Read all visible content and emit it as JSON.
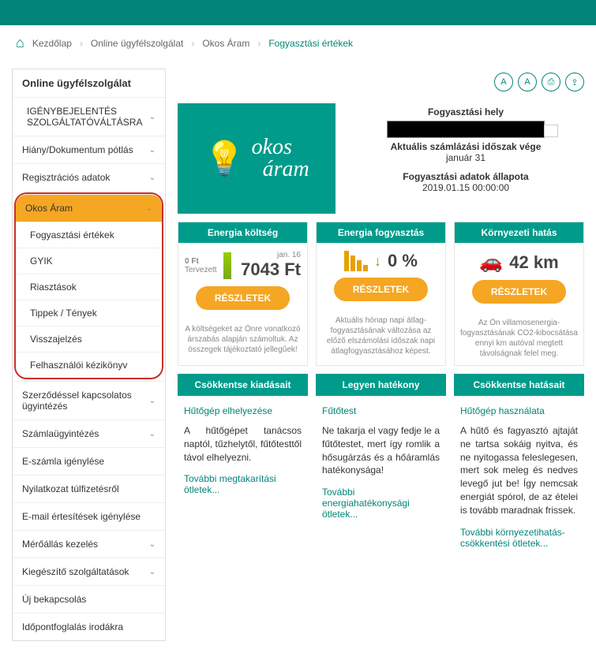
{
  "breadcrumb": {
    "home": "Kezdőlap",
    "b2": "Online ügyfélszolgálat",
    "b3": "Okos Áram",
    "current": "Fogyasztási értékek"
  },
  "sidebar": {
    "title": "Online ügyfélszolgálat",
    "items": [
      {
        "label": "IGÉNYBEJELENTÉS SZOLGÁLTATÓVÁLTÁSRA",
        "exp": true
      },
      {
        "label": "Hiány/Dokumentum pótlás",
        "exp": true
      },
      {
        "label": "Regisztrációs adatok",
        "exp": true
      }
    ],
    "active": {
      "label": "Okos Áram"
    },
    "subs": [
      {
        "label": "Fogyasztási értékek"
      },
      {
        "label": "GYIK"
      },
      {
        "label": "Riasztások"
      },
      {
        "label": "Tippek / Tények"
      },
      {
        "label": "Visszajelzés"
      },
      {
        "label": "Felhasználói kézikönyv"
      }
    ],
    "after": [
      {
        "label": "Szerződéssel kapcsolatos ügyintézés",
        "exp": true
      },
      {
        "label": "Számlaügyintézés",
        "exp": true
      },
      {
        "label": "E-számla igénylése",
        "exp": false
      },
      {
        "label": "Nyilatkozat túlfizetésről",
        "exp": false
      },
      {
        "label": "E-mail értesítések igénylése",
        "exp": false
      },
      {
        "label": "Mérőállás kezelés",
        "exp": true
      },
      {
        "label": "Kiegészítő szolgáltatások",
        "exp": true
      },
      {
        "label": "Új bekapcsolás",
        "exp": false
      },
      {
        "label": "Időpontfoglalás irodákra",
        "exp": false
      }
    ]
  },
  "logo": {
    "l1": "okos",
    "l2": "áram"
  },
  "info": {
    "loc_label": "Fogyasztási hely",
    "period_label": "Aktuális számlázási időszak vége",
    "period_value": "január 31",
    "state_label": "Fogyasztási adatok állapota",
    "state_value": "2019.01.15 00:00:00"
  },
  "cards": [
    {
      "header": "Energia költség",
      "sub1": "0 Ft",
      "sub2": "Tervezett",
      "sub3": "jan. 16",
      "value": "7043 Ft",
      "btn": "RÉSZLETEK",
      "note": "A költségeket az Önre vonatkozó árszabás alapján számoltuk. Az összegek tájékoztató jellegűek!"
    },
    {
      "header": "Energia fogyasztás",
      "value": "0 %",
      "btn": "RÉSZLETEK",
      "note": "Aktuális hónap napi átlag-fogyasztásának változása az előző elszámolási időszak napi átlagfogyasztásához képest."
    },
    {
      "header": "Környezeti hatás",
      "value": "42 km",
      "btn": "RÉSZLETEK",
      "note": "Az Ön villamosenergia-fogyasztásának CO2-kibocsátása ennyi km autóval megtett távolságnak felel meg."
    }
  ],
  "tips": [
    {
      "header": "Csökkentse kiadásait",
      "title": "Hűtőgép elhelyezése",
      "text": "A hűtőgépet tanácsos naptól, tűzhelytől, fűtőtesttől távol elhelyezni.",
      "link": "További megtakarítási ötletek..."
    },
    {
      "header": "Legyen hatékony",
      "title": "Fűtőtest",
      "text": "Ne takarja el vagy fedje le a fűtőtestet, mert így romlik a hősugárzás és a hőáramlás hatékonysága!",
      "link": "További energiahatékonysági ötletek..."
    },
    {
      "header": "Csökkentse hatásait",
      "title": "Hűtőgép használata",
      "text": "A hűtő és fagyasztó ajtaját ne tartsa sokáig nyitva, és ne nyitogassa feleslegesen, mert sok meleg és nedves levegő jut be! Így nemcsak energiát spórol, de az ételei is tovább maradnak frissek.",
      "link": "További környezetihatás-csökkentési ötletek..."
    }
  ]
}
